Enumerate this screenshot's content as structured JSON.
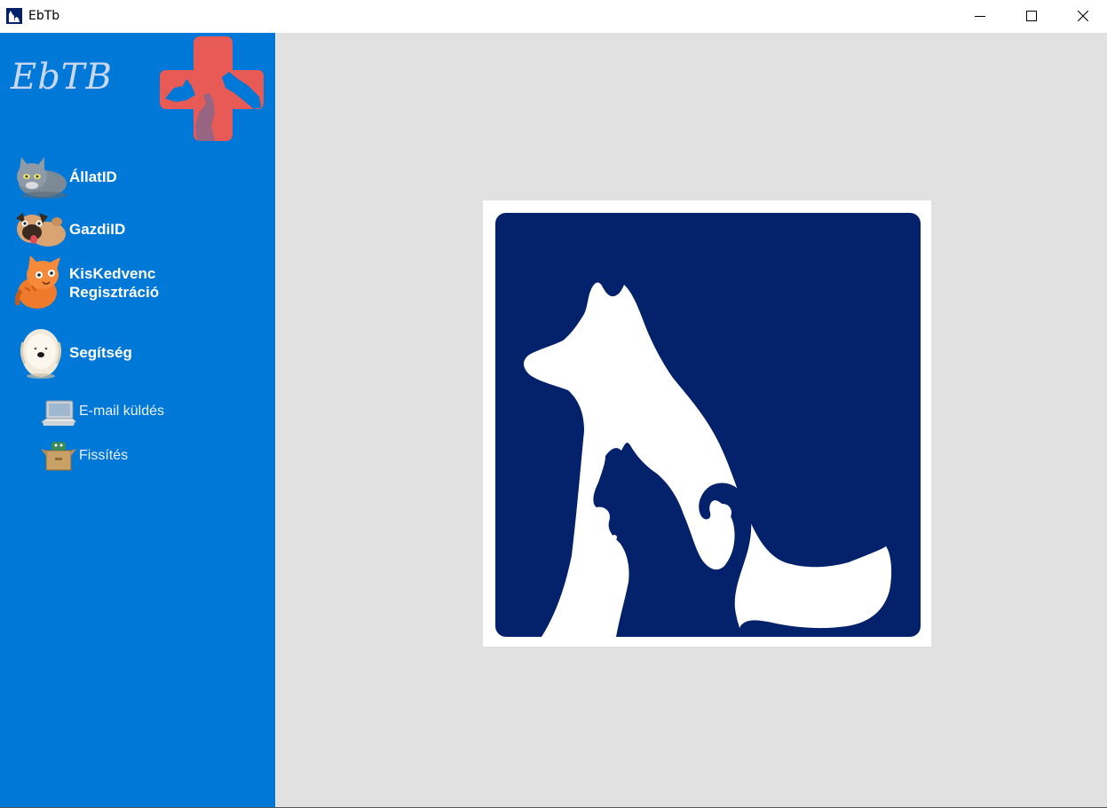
{
  "window": {
    "title": "EbTb",
    "controls": [
      "minimize-icon",
      "maximize-icon",
      "close-icon"
    ]
  },
  "sidebar": {
    "logo_text": "EbTB",
    "items": [
      {
        "label": "ÁllatID",
        "icon": "grey-cat-icon"
      },
      {
        "label": "GazdiID",
        "icon": "pug-dog-icon"
      },
      {
        "label": "KisKedvenc\nRegisztráció",
        "icon": "orange-cat-icon"
      },
      {
        "label": "Segítség",
        "icon": "sheepdog-icon"
      }
    ],
    "subitems": [
      {
        "label": "E-mail küldés",
        "icon": "laptop-icon"
      },
      {
        "label": "Fissítés",
        "icon": "box-icon"
      }
    ]
  },
  "colors": {
    "sidebar_bg": "#0078d7",
    "main_bg": "#e1e1e1",
    "logo_cross": "#e85a55",
    "pet_logo_bg": "#04216b"
  }
}
